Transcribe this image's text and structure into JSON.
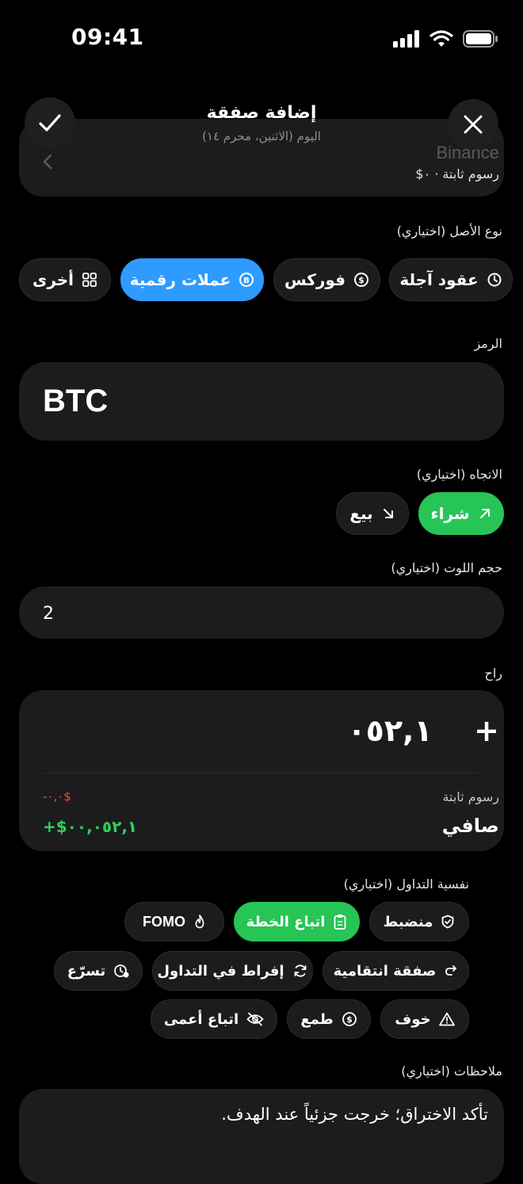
{
  "status_bar": {
    "time": "09:41"
  },
  "header": {
    "title": "إضافة صفقة",
    "subtitle": "اليوم (الاثنين، محرم ١٤)"
  },
  "broker": {
    "name": "Binance",
    "fee_text": "رسوم ثابتة · ٠$"
  },
  "asset_type": {
    "label": "نوع الأصل (اختياري)",
    "options": [
      {
        "label": "عقود آجلة",
        "icon": "history-icon",
        "selected": false
      },
      {
        "label": "فوركس",
        "icon": "dollar-exchange-icon",
        "selected": false
      },
      {
        "label": "عملات رقمية",
        "icon": "bitcoin-icon",
        "selected": true
      },
      {
        "label": "أخرى",
        "icon": "grid-icon",
        "selected": false
      }
    ]
  },
  "symbol": {
    "label": "الرمز",
    "value": "BTC"
  },
  "direction": {
    "label": "الاتجاه (اختياري)",
    "buy_label": "شراء",
    "sell_label": "بيع",
    "selected": "buy"
  },
  "lot_size": {
    "label": "حجم اللوت (اختياري)",
    "value": "2"
  },
  "pnl": {
    "label": "راح",
    "sign": "+",
    "value": "٠٥٢,١",
    "fees_label": "رسوم ثابتة",
    "fees_value": "-٠,٠$",
    "net_label": "صافي",
    "net_value": "+$٠٠,٠٥٢,١"
  },
  "psychology": {
    "label": "نفسية التداول (اختياري)",
    "tags": [
      {
        "label": "منضبط",
        "icon": "shield-check-icon",
        "selected": false
      },
      {
        "label": "اتباع الخطة",
        "icon": "clipboard-icon",
        "selected": true
      },
      {
        "label": "FOMO",
        "icon": "flame-icon",
        "selected": false
      },
      {
        "label": "صفقة انتقامية",
        "icon": "redo-arrow-icon",
        "selected": false
      },
      {
        "label": "إفراط في التداول",
        "icon": "refresh-icon",
        "selected": false
      },
      {
        "label": "تسرّع",
        "icon": "clock-alert-icon",
        "selected": false
      },
      {
        "label": "خوف",
        "icon": "warning-icon",
        "selected": false
      },
      {
        "label": "طمع",
        "icon": "dollar-circle-icon",
        "selected": false
      },
      {
        "label": "اتباع أعمى",
        "icon": "eye-off-icon",
        "selected": false
      }
    ]
  },
  "notes": {
    "label": "ملاحظات (اختياري)",
    "value": "تأكد الاختراق؛ خرجت جزئياً عند الهدف."
  },
  "colors": {
    "background": "#000000",
    "card": "#1c1c1e",
    "accent_blue": "#2f9bff",
    "accent_green": "#27c456",
    "loss_red": "#ff453a",
    "profit_green": "#30d158"
  }
}
